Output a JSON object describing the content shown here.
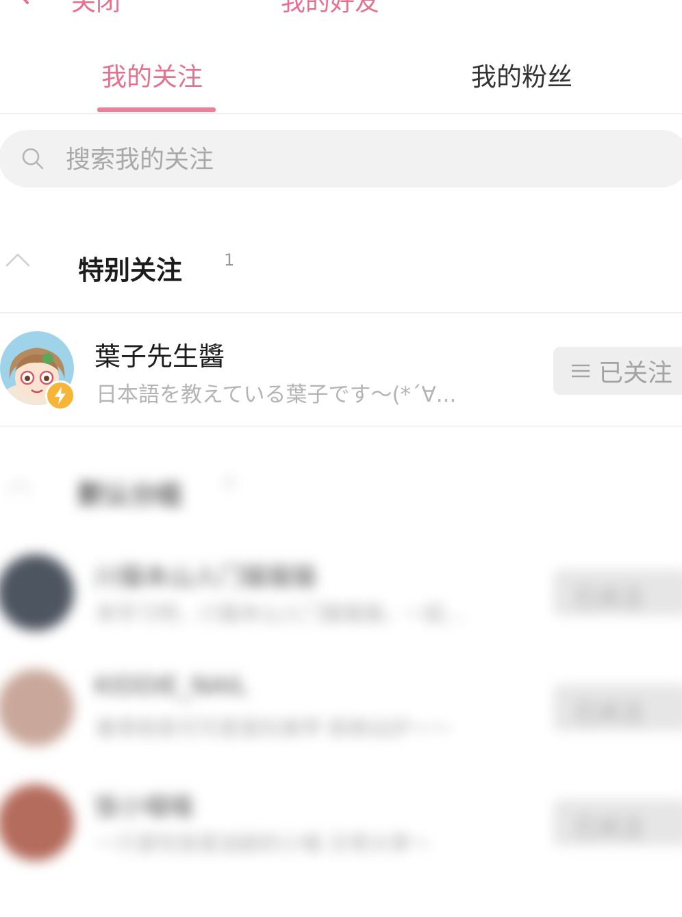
{
  "nav": {
    "back_label": "关闭",
    "title": "我的好友"
  },
  "tabs": [
    {
      "label": "我的关注",
      "active": true
    },
    {
      "label": "我的粉丝",
      "active": false
    }
  ],
  "search": {
    "placeholder": "搜索我的关注",
    "value": ""
  },
  "special_section": {
    "title": "特别关注",
    "count": "1",
    "users": [
      {
        "name": "葉子先生醬",
        "bio": "日本語を教えている葉子です～(*´∀...",
        "button_label": "已关注",
        "avatar_icon": "anime-girl-avatar",
        "badge_icon": "lightning-badge-icon"
      }
    ]
  },
  "blurred_section": {
    "title": "默认分组",
    "count": "7",
    "users": [
      {
        "name": "川猫本山人门猫猫猫",
        "bio": "来学习吧，川猫本山人门猫猫猫，一起...",
        "button_label": "已关注"
      },
      {
        "name": "KIDDIE_NAIL",
        "bio": "春季新款可可爱爱的美甲 新鲜出炉～～",
        "button_label": "已关注"
      },
      {
        "name": "饭小喵喵",
        "bio": "一只爱吃饭爱追剧的小喵 日常分享～",
        "button_label": "已关注"
      }
    ]
  },
  "colors": {
    "accent": "#e3728f",
    "badge": "#f6b537"
  }
}
